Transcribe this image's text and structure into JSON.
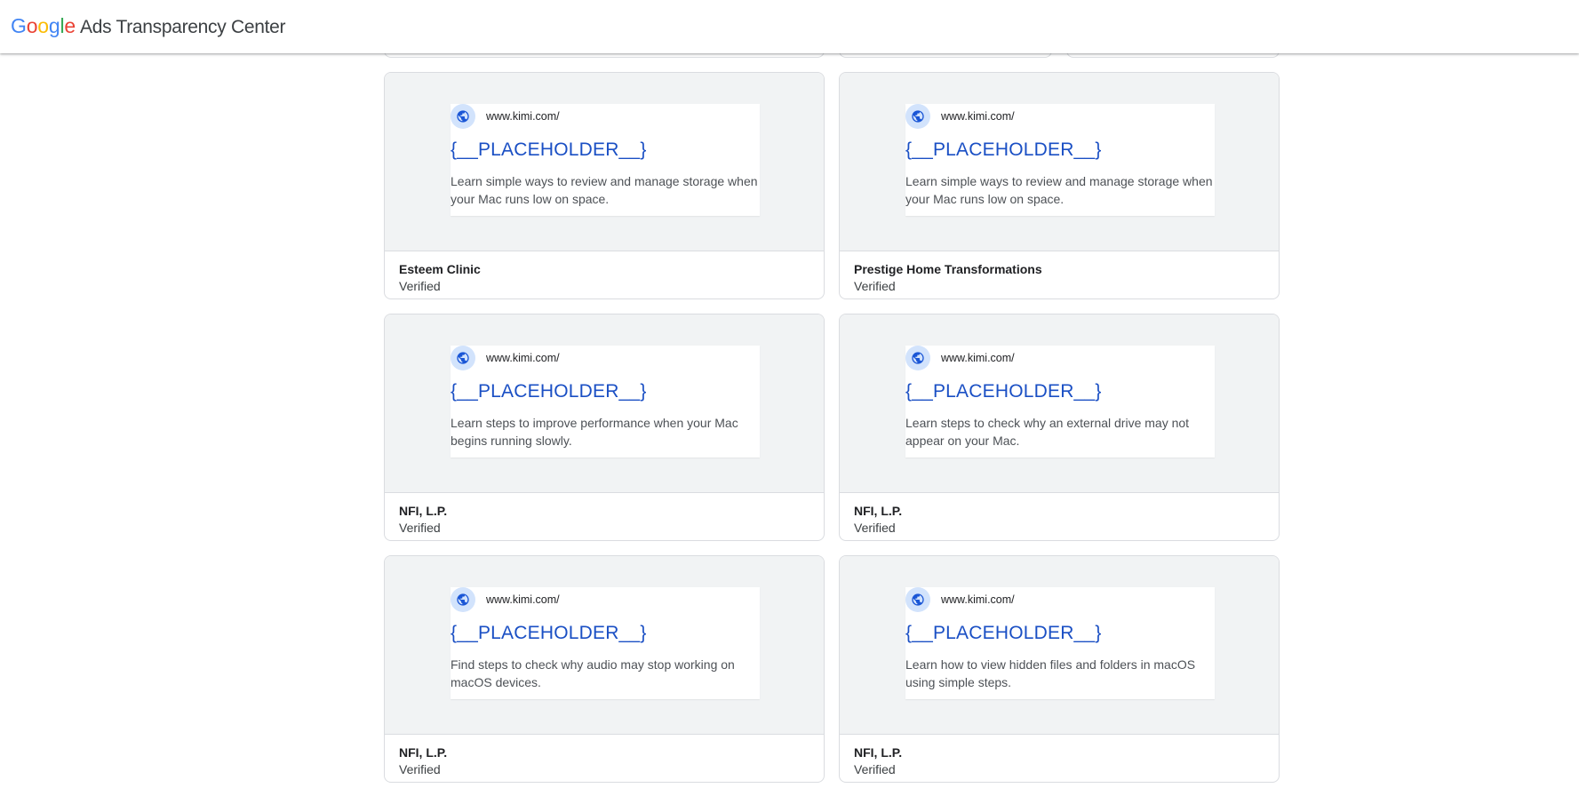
{
  "header": {
    "logo_letters": [
      "G",
      "o",
      "o",
      "g",
      "l",
      "e"
    ],
    "logo_colors": [
      "#4285F4",
      "#EA4335",
      "#FBBC05",
      "#4285F4",
      "#34A853",
      "#EA4335"
    ],
    "title": "Ads Transparency Center"
  },
  "icons": {
    "ad_icon": "globe-icon",
    "ad_icon_color": "#1a56d6",
    "ad_icon_bg": "#d2e3fc"
  },
  "cards": [
    {
      "url": "www.kimi.com/",
      "headline": "{__PLACEHOLDER__}",
      "description": "Learn simple ways to review and manage storage when your Mac runs low on space.",
      "advertiser": "Esteem Clinic",
      "status": "Verified"
    },
    {
      "url": "www.kimi.com/",
      "headline": "{__PLACEHOLDER__}",
      "description": "Learn simple ways to review and manage storage when your Mac runs low on space.",
      "advertiser": "Prestige Home Transformations",
      "status": "Verified"
    },
    {
      "url": "www.kimi.com/",
      "headline": "{__PLACEHOLDER__}",
      "description": "Learn steps to improve performance when your Mac begins running slowly.",
      "advertiser": "NFI, L.P.",
      "status": "Verified"
    },
    {
      "url": "www.kimi.com/",
      "headline": "{__PLACEHOLDER__}",
      "description": "Learn steps to check why an external drive may not appear on your Mac.",
      "advertiser": "NFI, L.P.",
      "status": "Verified"
    },
    {
      "url": "www.kimi.com/",
      "headline": "{__PLACEHOLDER__}",
      "description": "Find steps to check why audio may stop working on macOS devices.",
      "advertiser": "NFI, L.P.",
      "status": "Verified"
    },
    {
      "url": "www.kimi.com/",
      "headline": "{__PLACEHOLDER__}",
      "description": "Learn how to view hidden files and folders in macOS using simple steps.",
      "advertiser": "NFI, L.P.",
      "status": "Verified"
    }
  ]
}
